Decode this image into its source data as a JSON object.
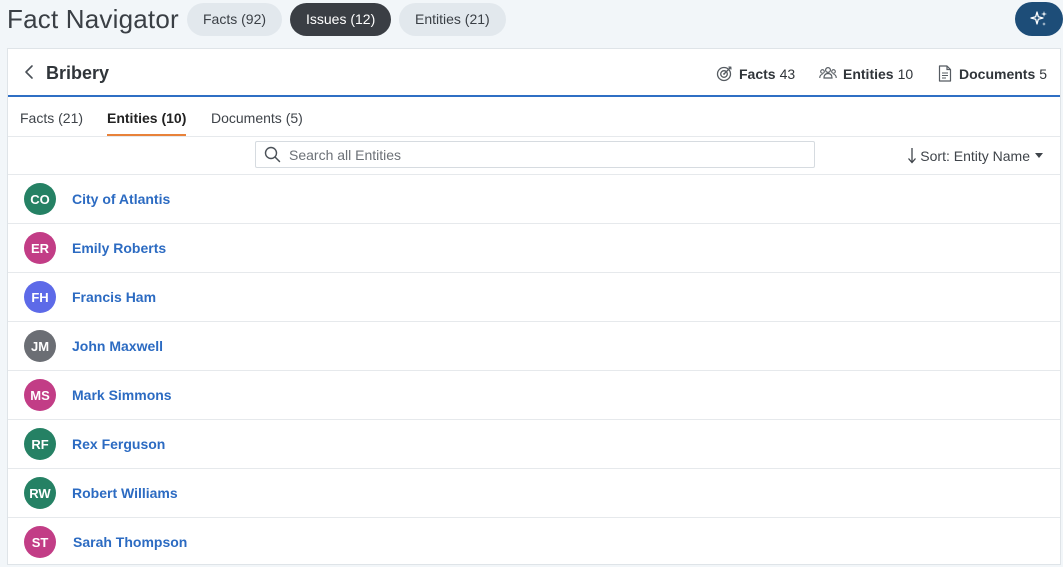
{
  "app": {
    "title": "Fact Navigator",
    "nav_pills": [
      {
        "label": "Facts (92)",
        "active": false
      },
      {
        "label": "Issues (12)",
        "active": true
      },
      {
        "label": "Entities (21)",
        "active": false
      }
    ],
    "magic_button_icon": "sparkle-icon"
  },
  "issue": {
    "back_icon": "chevron-left-icon",
    "title": "Bribery",
    "stats": {
      "facts": {
        "label": "Facts",
        "value": "43",
        "icon": "target-icon"
      },
      "entities": {
        "label": "Entities",
        "value": "10",
        "icon": "people-icon"
      },
      "documents": {
        "label": "Documents",
        "value": "5",
        "icon": "document-icon"
      }
    }
  },
  "tabs": [
    {
      "label": "Facts (21)",
      "active": false
    },
    {
      "label": "Entities (10)",
      "active": true
    },
    {
      "label": "Documents (5)",
      "active": false
    }
  ],
  "toolbar": {
    "search_placeholder": "Search all Entities",
    "search_value": "",
    "sort_label": "Sort: Entity Name",
    "sort_icon": "arrow-down-icon"
  },
  "entities": [
    {
      "initials": "CO",
      "name": "City of Atlantis",
      "color": "#258164"
    },
    {
      "initials": "ER",
      "name": "Emily Roberts",
      "color": "#c23d86"
    },
    {
      "initials": "FH",
      "name": "Francis Ham",
      "color": "#5d6ae8"
    },
    {
      "initials": "JM",
      "name": "John Maxwell",
      "color": "#6b6e74"
    },
    {
      "initials": "MS",
      "name": "Mark Simmons",
      "color": "#c23d86"
    },
    {
      "initials": "RF",
      "name": "Rex Ferguson",
      "color": "#258164"
    },
    {
      "initials": "RW",
      "name": "Robert Williams",
      "color": "#258164"
    },
    {
      "initials": "ST",
      "name": "Sarah Thompson",
      "color": "#c23d86"
    }
  ],
  "colors": {
    "accent_blue": "#2f6fc4",
    "tab_underline": "#e8823a",
    "magic_button": "#1d4d78",
    "active_pill": "#3a3e44"
  }
}
